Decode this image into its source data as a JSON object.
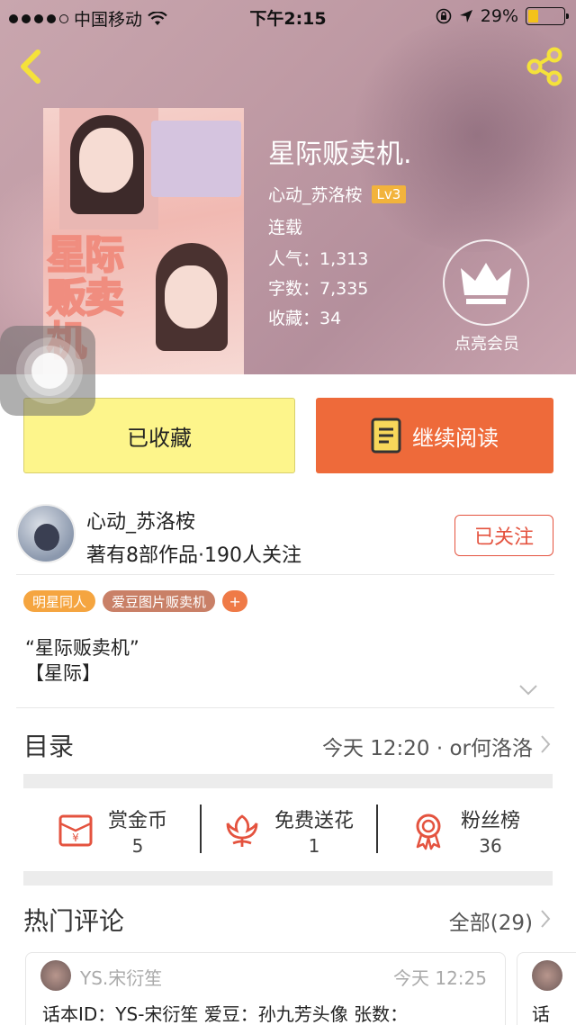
{
  "status_bar": {
    "carrier": "中国移动",
    "time": "下午2:15",
    "battery": "29%",
    "battery_level": 0.29
  },
  "book": {
    "title": "星际贩卖机.",
    "author": "心动_苏洛桉",
    "level": "Lv3",
    "status": "连载",
    "popularity": "人气：1,313",
    "word_count": "字数：7,335",
    "favorites": "收藏：34",
    "vip_label": "点亮会员",
    "cover_text": "星际贩卖机"
  },
  "actions": {
    "collect_label": "已收藏",
    "read_label": "继续阅读"
  },
  "author_card": {
    "name": "心动_苏洛桉",
    "summary": "著有8部作品·190人关注",
    "follow_label": "已关注"
  },
  "tags": [
    "明星同人",
    "爱豆图片贩卖机"
  ],
  "tag_add": "+",
  "description": {
    "line1": "“星际贩卖机”",
    "line2": "【星际】"
  },
  "toc": {
    "label": "目录",
    "latest": "今天 12:20 · or何洛洛"
  },
  "stats": [
    {
      "label": "赏金币",
      "value": "5",
      "icon": "red-envelope-icon"
    },
    {
      "label": "免费送花",
      "value": "1",
      "icon": "flower-icon"
    },
    {
      "label": "粉丝榜",
      "value": "36",
      "icon": "medal-icon"
    }
  ],
  "hot_comments": {
    "title": "热门评论",
    "all_label": "全部(29)",
    "items": [
      {
        "user": "YS.宋衍笙",
        "time": "今天 12:25",
        "body": "话本ID：YS-宋衍笙 爱豆：孙九芳头像 张数："
      },
      {
        "body": "话"
      }
    ]
  },
  "colors": {
    "accent_orange": "#ee6a3a",
    "collect_yellow": "#fdf58b",
    "follow_red": "#e4533f",
    "level_badge": "#f2b33c",
    "icon_red": "#e4533f"
  }
}
